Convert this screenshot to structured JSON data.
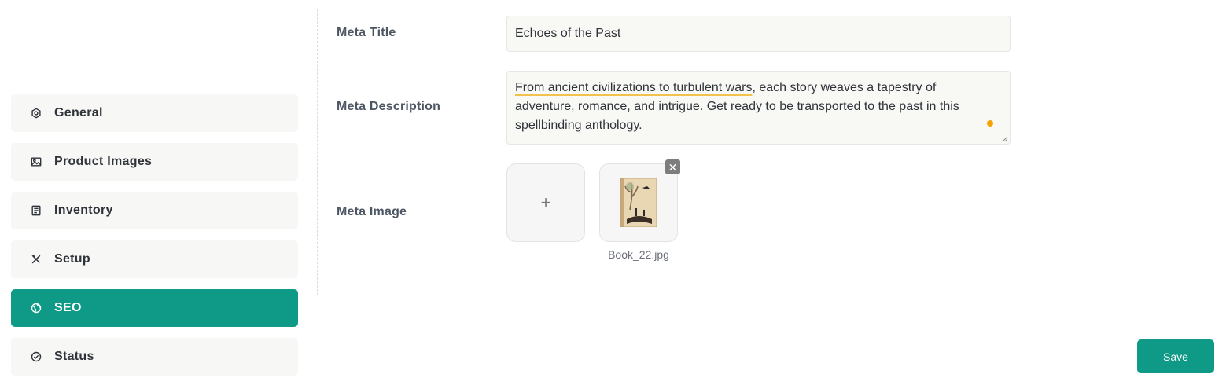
{
  "sidebar": {
    "items": [
      {
        "label": "General",
        "icon": "settings-hexagon-icon",
        "active": false
      },
      {
        "label": "Product Images",
        "icon": "image-icon",
        "active": false
      },
      {
        "label": "Inventory",
        "icon": "document-icon",
        "active": false
      },
      {
        "label": "Setup",
        "icon": "tools-icon",
        "active": false
      },
      {
        "label": "SEO",
        "icon": "globe-icon",
        "active": true
      },
      {
        "label": "Status",
        "icon": "check-circle-icon",
        "active": false
      }
    ]
  },
  "form": {
    "meta_title": {
      "label": "Meta Title",
      "value": "Echoes of the Past"
    },
    "meta_description": {
      "label": "Meta Description",
      "highlighted": "From ancient civilizations to turbulent wars",
      "rest": ", each story weaves a tapestry of adventure, romance, and intrigue. Get ready to be transported to the past in this spellbinding anthology."
    },
    "meta_image": {
      "label": "Meta Image",
      "add_symbol": "+",
      "remove_symbol": "✕",
      "filename": "Book_22.jpg"
    }
  },
  "actions": {
    "save_label": "Save"
  },
  "colors": {
    "accent": "#0e9a86",
    "field_bg": "#f8f8f5",
    "warning_dot": "#f5a300"
  }
}
